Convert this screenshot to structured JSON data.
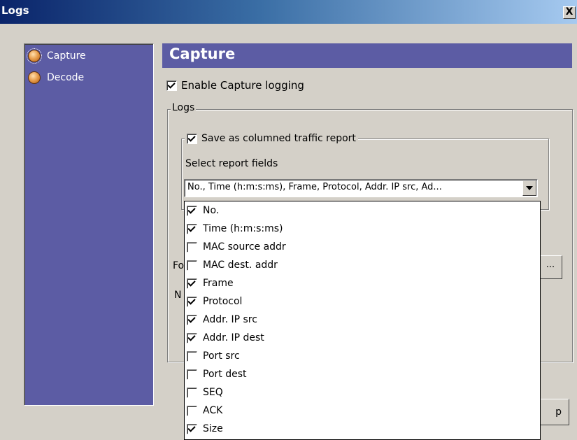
{
  "window": {
    "title": "Logs",
    "close_label": "X"
  },
  "nav": {
    "items": [
      {
        "label": "Capture",
        "icon": "orange-sphere-icon",
        "selected": true
      },
      {
        "label": "Decode",
        "icon": "orange-sphere-icon",
        "selected": false
      }
    ]
  },
  "panel": {
    "header": "Capture",
    "enable_logging": {
      "label": "Enable Capture logging",
      "checked": true
    },
    "logs_group_label": "Logs",
    "save_columned": {
      "label": "Save as columned traffic report",
      "checked": true
    },
    "select_fields_label": "Select report fields",
    "fields_combo_value": "No., Time (h:m:s:ms), Frame, Protocol, Addr. IP src, Ad...",
    "partial_label_fo": "Fo",
    "partial_label_n": "N",
    "browse_button_label": "...",
    "bottom_button_partial_label": "p"
  },
  "fields_dropdown": {
    "options": [
      {
        "label": "No.",
        "checked": true
      },
      {
        "label": "Time (h:m:s:ms)",
        "checked": true
      },
      {
        "label": "MAC source addr",
        "checked": false
      },
      {
        "label": "MAC dest. addr",
        "checked": false
      },
      {
        "label": "Frame",
        "checked": true
      },
      {
        "label": "Protocol",
        "checked": true
      },
      {
        "label": "Addr. IP src",
        "checked": true
      },
      {
        "label": "Addr. IP dest",
        "checked": true
      },
      {
        "label": "Port src",
        "checked": false
      },
      {
        "label": "Port dest",
        "checked": false
      },
      {
        "label": "SEQ",
        "checked": false
      },
      {
        "label": "ACK",
        "checked": false
      },
      {
        "label": "Size",
        "checked": true
      }
    ]
  },
  "colors": {
    "title_bar_start": "#0a246a",
    "title_bar_end": "#a6caf0",
    "panel_accent": "#5c5ca4",
    "dialog_face": "#d4d0c8"
  }
}
